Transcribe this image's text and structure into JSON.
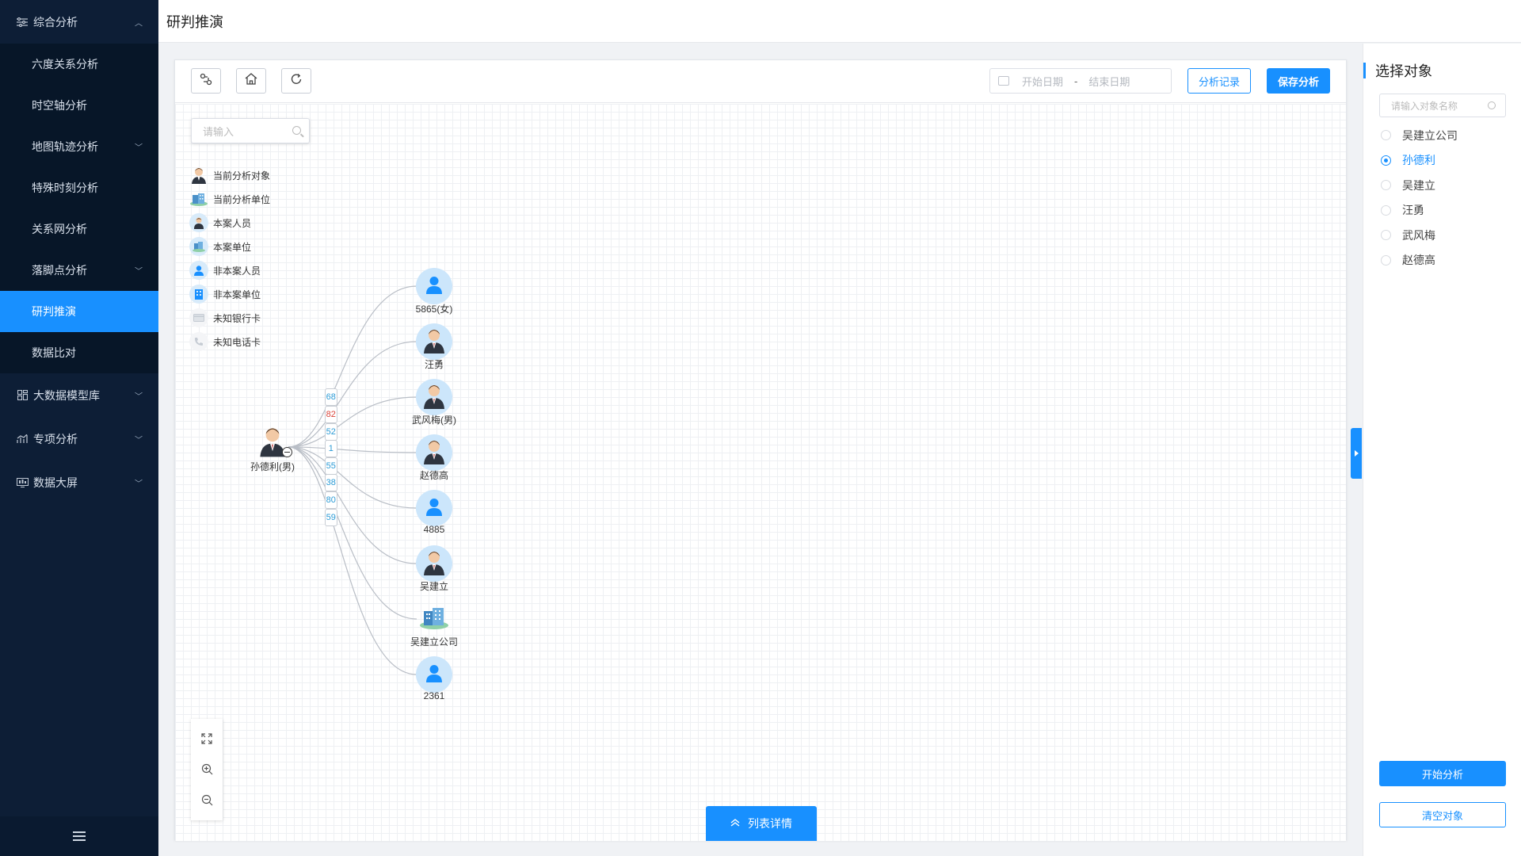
{
  "header": {
    "title": "研判推演"
  },
  "sidebar": {
    "groups": [
      {
        "label": "综合分析",
        "icon": "sliders-icon",
        "expanded": true,
        "items": [
          {
            "label": "六度关系分析"
          },
          {
            "label": "时空轴分析"
          },
          {
            "label": "地图轨迹分析",
            "has_children": true
          },
          {
            "label": "特殊时刻分析"
          },
          {
            "label": "关系网分析"
          },
          {
            "label": "落脚点分析",
            "has_children": true
          },
          {
            "label": "研判推演",
            "active": true
          },
          {
            "label": "数据比对"
          }
        ]
      },
      {
        "label": "大数据模型库",
        "icon": "grid-icon"
      },
      {
        "label": "专项分析",
        "icon": "bar-chart-icon"
      },
      {
        "label": "数据大屏",
        "icon": "monitor-icon"
      }
    ]
  },
  "toolbar": {
    "date_start_placeholder": "开始日期",
    "date_separator": "-",
    "date_end_placeholder": "结束日期",
    "history_label": "分析记录",
    "save_label": "保存分析"
  },
  "canvas": {
    "search_placeholder": "请输入",
    "legend": [
      {
        "label": "当前分析对象",
        "icon": "person-suit-icon"
      },
      {
        "label": "当前分析单位",
        "icon": "building-icon"
      },
      {
        "label": "本案人员",
        "icon": "person-small-icon"
      },
      {
        "label": "本案单位",
        "icon": "building-small-icon"
      },
      {
        "label": "非本案人员",
        "icon": "person-blue-icon"
      },
      {
        "label": "非本案单位",
        "icon": "building-blue-icon"
      },
      {
        "label": "未知银行卡",
        "icon": "bank-card-icon"
      },
      {
        "label": "未知电话卡",
        "icon": "phone-icon"
      }
    ],
    "center_node": {
      "label": "孙德利(男)"
    },
    "nodes": [
      {
        "label": "5865(女)",
        "type": "person-blue",
        "edge": "68",
        "edge_color": "#2b9bd6"
      },
      {
        "label": "汪勇",
        "type": "person-suit",
        "edge": "82",
        "edge_color": "#d9443a"
      },
      {
        "label": "武风梅(男)",
        "type": "person-suit",
        "edge": "52",
        "edge_color": "#2b9bd6"
      },
      {
        "label": "赵德高",
        "type": "person-suit",
        "edge": "1",
        "edge_color": "#2b9bd6"
      },
      {
        "label": "4885",
        "type": "person-blue",
        "edge": "55",
        "edge_color": "#2b9bd6"
      },
      {
        "label": "吴建立",
        "type": "person-suit",
        "edge": "38",
        "edge_color": "#2b9bd6"
      },
      {
        "label": "吴建立公司",
        "type": "building",
        "edge": "80",
        "edge_color": "#2b9bd6"
      },
      {
        "label": "2361",
        "type": "person-blue",
        "edge": "59",
        "edge_color": "#2b9bd6"
      }
    ],
    "list_button_label": "列表详情"
  },
  "right_panel": {
    "title": "选择对象",
    "search_placeholder": "请输入对象名称",
    "objects": [
      {
        "label": "吴建立公司",
        "checked": false
      },
      {
        "label": "孙德利",
        "checked": true
      },
      {
        "label": "吴建立",
        "checked": false
      },
      {
        "label": "汪勇",
        "checked": false
      },
      {
        "label": "武风梅",
        "checked": false
      },
      {
        "label": "赵德高",
        "checked": false
      }
    ],
    "start_label": "开始分析",
    "clear_label": "清空对象"
  },
  "colors": {
    "primary": "#1890ff",
    "sidebar_bg": "#0d1e36",
    "sidebar_sub_bg": "#071628"
  }
}
